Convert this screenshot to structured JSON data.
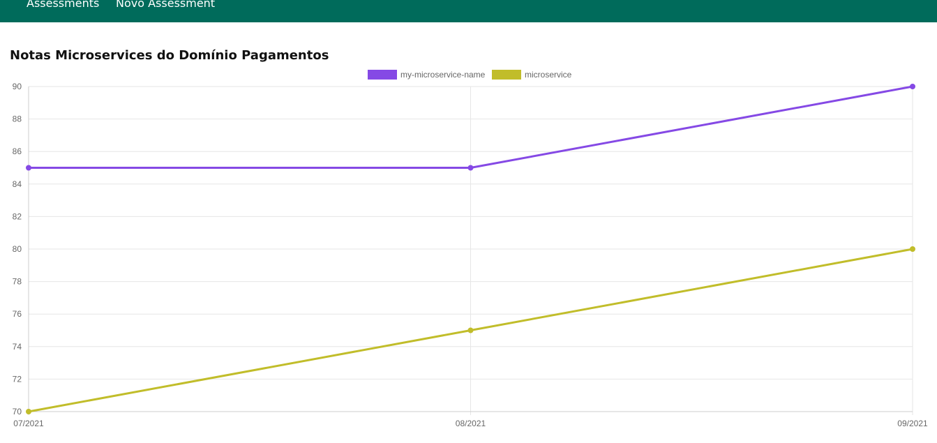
{
  "nav": {
    "items": [
      {
        "label": "Assessments"
      },
      {
        "label": "Novo Assessment"
      }
    ],
    "background": "#006b5b"
  },
  "page": {
    "title": "Notas Microservices do Domínio Pagamentos"
  },
  "chart_data": {
    "type": "line",
    "title": "",
    "xlabel": "",
    "ylabel": "",
    "categories": [
      "07/2021",
      "08/2021",
      "09/2021"
    ],
    "ylim": [
      70,
      90
    ],
    "yticks": [
      70,
      72,
      74,
      76,
      78,
      80,
      82,
      84,
      86,
      88,
      90
    ],
    "grid": true,
    "legend_position": "top-center",
    "series": [
      {
        "name": "my-microservice-name",
        "color": "#8549e5",
        "values": [
          85,
          85,
          90
        ]
      },
      {
        "name": "microservice",
        "color": "#c1bd2a",
        "values": [
          70,
          75,
          80
        ]
      }
    ]
  }
}
